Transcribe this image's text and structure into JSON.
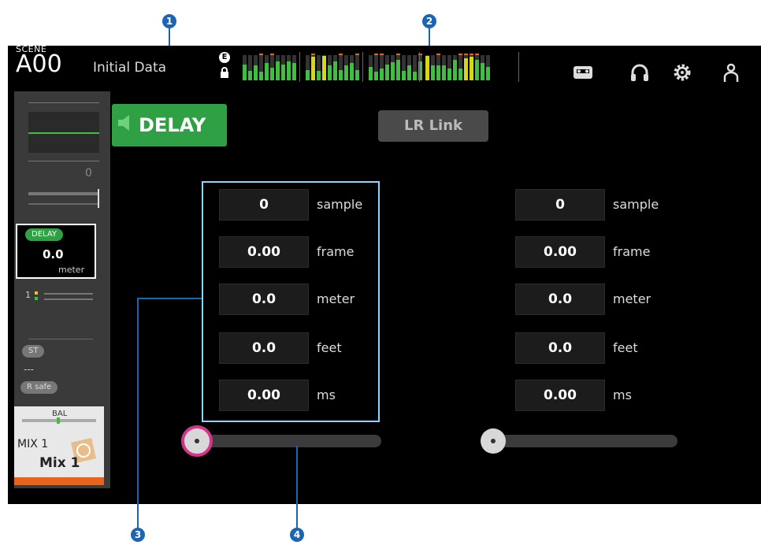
{
  "header": {
    "scene_label": "SCENE",
    "scene_number": "A00",
    "scene_title": "Initial Data",
    "e_badge": "E",
    "icons": [
      "recorder-icon",
      "headphones-icon",
      "gear-icon",
      "user-icon"
    ]
  },
  "strip": {
    "value_zero": "0",
    "delay_badge": "DELAY",
    "delay_value": "0.0",
    "delay_unit": "meter",
    "bus_one": "1",
    "st_badge": "ST",
    "dash_text": "---",
    "r_safe": "R safe",
    "bal_label": "BAL",
    "mix_small": "MIX 1",
    "mix_big": "Mix 1"
  },
  "buttons": {
    "delay": "DELAY",
    "lr_link": "LR Link"
  },
  "left_fields": [
    {
      "value": "0",
      "unit": "sample"
    },
    {
      "value": "0.00",
      "unit": "frame"
    },
    {
      "value": "0.0",
      "unit": "meter"
    },
    {
      "value": "0.0",
      "unit": "feet"
    },
    {
      "value": "0.00",
      "unit": "ms"
    }
  ],
  "right_fields": [
    {
      "value": "0",
      "unit": "sample"
    },
    {
      "value": "0.00",
      "unit": "frame"
    },
    {
      "value": "0.0",
      "unit": "meter"
    },
    {
      "value": "0.0",
      "unit": "feet"
    },
    {
      "value": "0.00",
      "unit": "ms"
    }
  ],
  "sliders": {
    "left_level": 0,
    "right_level": 0
  },
  "callouts": [
    "1",
    "2",
    "3",
    "4"
  ],
  "colors": {
    "delay_on": "#2fa043",
    "callout": "#1a65b4",
    "selection": "#8fd4ff",
    "knob_ring": "#d6338a",
    "accent_orange": "#e8641c"
  }
}
